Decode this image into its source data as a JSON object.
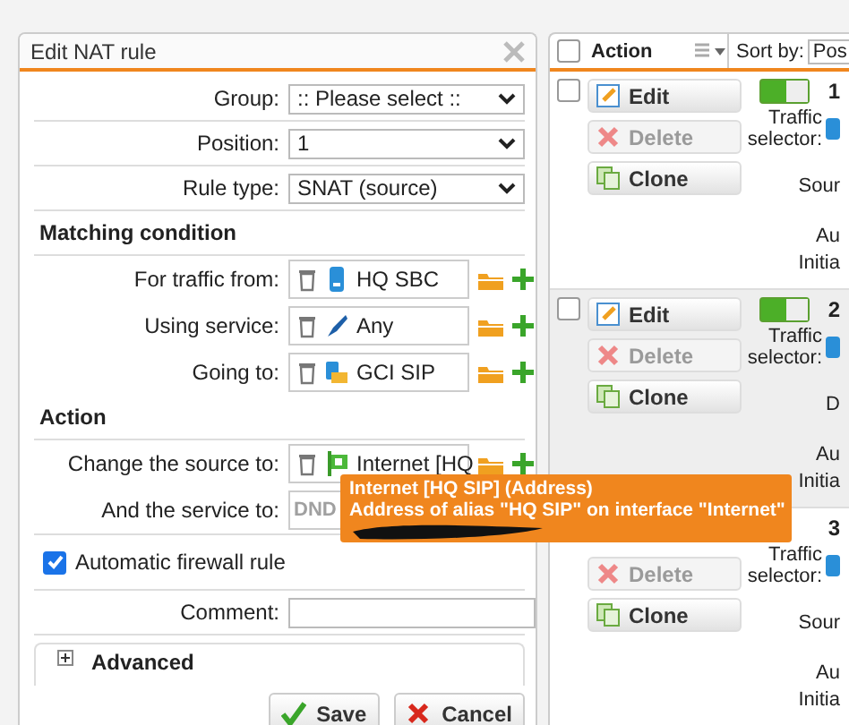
{
  "dialog": {
    "title": "Edit NAT rule",
    "fields": [
      {
        "kind": "select",
        "label": "Group:",
        "value": ":: Please select ::"
      },
      {
        "kind": "select",
        "label": "Position:",
        "value": "1"
      },
      {
        "kind": "select",
        "label": "Rule type:",
        "value": "SNAT (source)"
      },
      {
        "kind": "section",
        "label": "Matching condition"
      },
      {
        "kind": "object",
        "label": "For traffic from:",
        "value": "HQ SBC"
      },
      {
        "kind": "object",
        "label": "Using service:",
        "value": "Any"
      },
      {
        "kind": "object",
        "label": "Going to:",
        "value": "GCI SIP"
      },
      {
        "kind": "section",
        "label": "Action"
      },
      {
        "kind": "object",
        "label": "Change the source to:",
        "value": "Internet [HQ"
      },
      {
        "kind": "disabled",
        "label": "And the service to:",
        "placeholder": "DND"
      },
      {
        "kind": "checkbox",
        "label": "Automatic firewall rule",
        "checked": true
      },
      {
        "kind": "text",
        "label": "Comment:"
      },
      {
        "kind": "expander",
        "label": "Advanced",
        "expanded": false
      }
    ],
    "buttons": [
      {
        "kind": "save",
        "label": "Save"
      },
      {
        "kind": "cancel",
        "label": "Cancel"
      }
    ]
  },
  "tooltip": {
    "title": "Internet [HQ SIP] (Address)",
    "text": "Address of alias \"HQ SIP\" on interface \"Internet\""
  },
  "rule_list": {
    "header": {
      "checked": false,
      "action": "Action",
      "sort_label": "Sort by:",
      "sort_value": "Pos"
    },
    "rules": [
      {
        "number": "1",
        "checked": false,
        "enabled": true,
        "selected": false,
        "buttons": [
          {
            "kind": "edit",
            "label": "Edit",
            "disabled": false
          },
          {
            "kind": "delete",
            "label": "Delete",
            "disabled": true
          },
          {
            "kind": "clone",
            "label": "Clone",
            "disabled": false
          }
        ],
        "details": [
          "Traffic selector:",
          "Sour",
          "Au",
          "Initia"
        ]
      },
      {
        "number": "2",
        "checked": false,
        "enabled": true,
        "selected": true,
        "buttons": [
          {
            "kind": "edit",
            "label": "Edit",
            "disabled": false
          },
          {
            "kind": "delete",
            "label": "Delete",
            "disabled": true
          },
          {
            "kind": "clone",
            "label": "Clone",
            "disabled": false
          }
        ],
        "details": [
          "Traffic selector:",
          "D",
          "Au",
          "Initia"
        ]
      },
      {
        "number": "3",
        "selected": false,
        "buttons": [
          {
            "kind": "delete",
            "label": "Delete",
            "disabled": true
          },
          {
            "kind": "clone",
            "label": "Clone",
            "disabled": false
          }
        ],
        "details": [
          "Traffic selector:",
          "Sour",
          "Au",
          "Initia"
        ]
      }
    ]
  }
}
